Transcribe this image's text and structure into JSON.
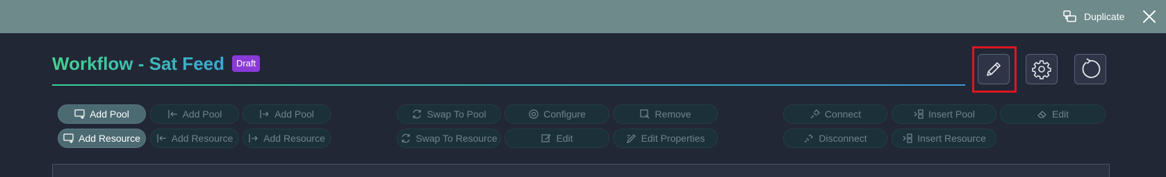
{
  "header": {
    "duplicate_label": "Duplicate",
    "duplicate_icon": "duplicate-icon",
    "close_icon": "close-icon"
  },
  "workflow": {
    "title": "Workflow - Sat Feed",
    "status_badge": "Draft"
  },
  "actions": {
    "edit_icon": "pencil-icon",
    "settings_icon": "gear-icon",
    "refresh_icon": "refresh-icon"
  },
  "toolbar": {
    "add_pool": "Add Pool",
    "add_pool_left": "Add Pool",
    "add_pool_right": "Add Pool",
    "add_resource": "Add Resource",
    "add_resource_left": "Add Resource",
    "add_resource_right": "Add Resource",
    "swap_to_pool": "Swap To Pool",
    "swap_to_resource": "Swap To Resource",
    "configure": "Configure",
    "edit": "Edit",
    "remove": "Remove",
    "edit_properties": "Edit Properties",
    "connect": "Connect",
    "disconnect": "Disconnect",
    "insert_pool": "Insert Pool",
    "insert_resource": "Insert Resource",
    "edit_connection": "Edit"
  },
  "colors": {
    "topbar": "#6e8a8a",
    "background": "#222736",
    "title_gradient_start": "#43d48d",
    "title_gradient_end": "#3aa8d6",
    "badge": "#8a3ad6",
    "highlight": "#e0161f"
  }
}
